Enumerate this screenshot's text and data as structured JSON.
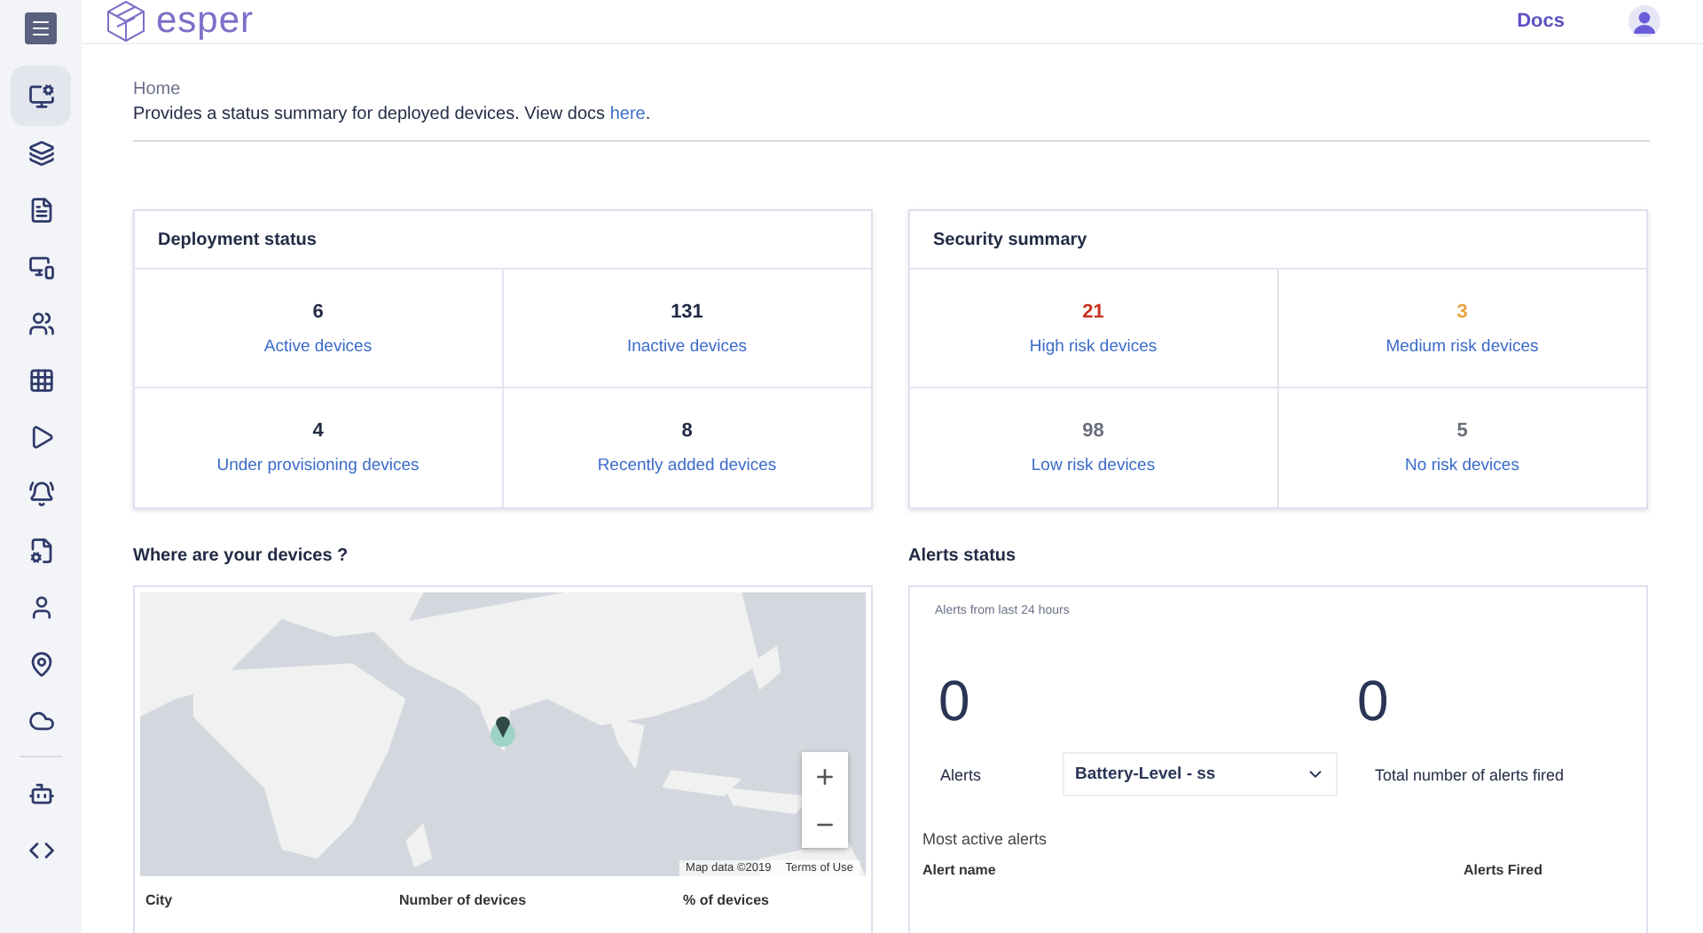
{
  "sidebar": {
    "items": [
      {
        "selected": true
      },
      {
        "selected": false
      },
      {
        "selected": false
      },
      {
        "selected": false
      },
      {
        "selected": false
      },
      {
        "selected": false
      },
      {
        "selected": false
      },
      {
        "selected": false
      },
      {
        "selected": false
      },
      {
        "selected": false
      },
      {
        "selected": false
      },
      {
        "selected": false
      },
      {
        "selected": false
      },
      {
        "selected": false
      }
    ]
  },
  "header": {
    "logo": "esper",
    "links": [
      "Docs"
    ]
  },
  "page": {
    "breadcrumb": "Home",
    "description": "Provides a status summary for deployed devices. View docs ",
    "description_link": "here",
    "description_end": "."
  },
  "deployment_status": {
    "title": "Deployment status",
    "stats": [
      {
        "value": "6",
        "label": "Active devices",
        "color": "#222b45"
      },
      {
        "value": "131",
        "label": "Inactive devices",
        "color": "#222b45"
      },
      {
        "value": "4",
        "label": "Under provisioning devices",
        "color": "#222b45"
      },
      {
        "value": "8",
        "label": "Recently added devices",
        "color": "#222b45"
      }
    ]
  },
  "security_summary": {
    "title": "Security summary",
    "stats": [
      {
        "value": "21",
        "label": "High risk devices",
        "color": "#c9341f"
      },
      {
        "value": "3",
        "label": "Medium risk devices",
        "color": "#e8a33d"
      },
      {
        "value": "98",
        "label": "Low risk devices",
        "color": "#6b6f7b"
      },
      {
        "value": "5",
        "label": "No risk devices",
        "color": "#6b6f7b"
      }
    ]
  },
  "map_section": {
    "title": "Where are your devices ?",
    "map": {
      "zoom_in": "+",
      "zoom_out": "−",
      "attribution": "Map data ©2019",
      "terms": "Terms of Use"
    },
    "table": {
      "columns": [
        "City",
        "Number of devices",
        "% of devices"
      ]
    }
  },
  "alerts_status": {
    "title": "Alerts status",
    "period": "Alerts from last 24 hours",
    "alerts_count": "0",
    "total_count": "0",
    "alerts_label": "Alerts",
    "selected_alert": "Battery-Level - ss",
    "total_label": "Total number of alerts fired",
    "most_active_title": "Most active alerts",
    "columns": [
      "Alert name",
      "Alerts Fired"
    ]
  }
}
